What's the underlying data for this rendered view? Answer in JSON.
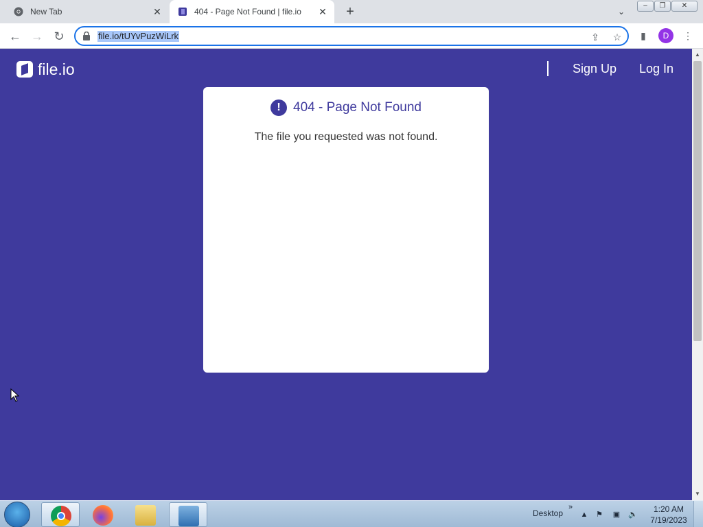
{
  "browser": {
    "tabs": [
      {
        "title": "New Tab",
        "active": false,
        "icon": "chrome-icon"
      },
      {
        "title": "404 - Page Not Found | file.io",
        "active": true,
        "icon": "fileio-favicon"
      }
    ],
    "new_tab_label": "+",
    "address": "file.io/tUYvPuzWiLrk",
    "profile_initial": "D",
    "window_controls": [
      "minimize",
      "restore",
      "close"
    ]
  },
  "site": {
    "logo_text": "file.io",
    "nav": {
      "sign_up": "Sign Up",
      "log_in": "Log In"
    },
    "error": {
      "title": "404 - Page Not Found",
      "message": "The file you requested was not found."
    }
  },
  "taskbar": {
    "apps": [
      "chrome-icon",
      "firefox-icon",
      "file-explorer-icon",
      "control-panel-icon"
    ],
    "desktop_label": "Desktop",
    "clock": {
      "time": "1:20 AM",
      "date": "7/19/2023"
    }
  },
  "colors": {
    "brand": "#3f3a9d",
    "profile": "#9334e6",
    "focus": "#1a73e8"
  }
}
